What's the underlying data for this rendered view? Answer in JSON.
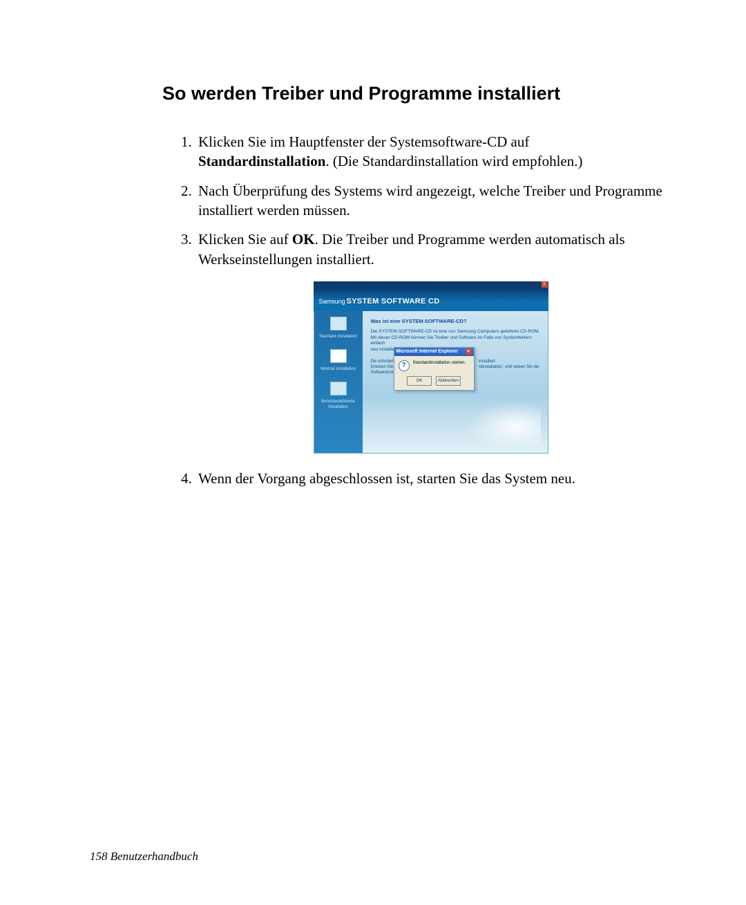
{
  "heading": "So werden Treiber und Programme installiert",
  "steps": {
    "s1_a": "Klicken Sie im Hauptfenster der Systemsoftware-CD auf ",
    "s1_bold": "Standardinstallation",
    "s1_b": ". (Die Standardinstallation wird empfohlen.)",
    "s2": "Nach Überprüfung des Systems wird angezeigt, welche Treiber und Programme installiert werden müssen.",
    "s3_a": "Klicken Sie auf ",
    "s3_bold": "OK",
    "s3_b": ". Die Treiber und Programme werden automatisch als Werkseinstellungen installiert.",
    "s4": "Wenn der Vorgang abgeschlossen ist, starten Sie das System neu."
  },
  "screenshot": {
    "close_x": "×",
    "brand_small": "Samsung",
    "brand_big": "SYSTEM SOFTWARE CD",
    "side": {
      "standard": "Standard Installation",
      "minimal": "Minimal Installation",
      "custom": "Benutzerdefinierte Installation"
    },
    "main": {
      "q": "Was ist eine SYSTEM-SOFTWARE-CD?",
      "desc1": "Die SYSTEM-SOFTWARE-CD ist eine von Samsung Computers gelieferte CD-ROM.",
      "desc2": "Mit dieser CD-ROM können Sie Treiber und Software im Falle von Systemfehlern einfach",
      "desc3": "neu installieren.",
      "left_cut1": "Die erforderli",
      "left_cut2": "Drücken Sie 'S",
      "left_cut3": "Softwareinsta",
      "right_cut1": "installiert.",
      "right_cut2": "rdinstallation', und setzen Sie die"
    },
    "dialog": {
      "title": "Microsoft Internet Explorer",
      "x": "×",
      "q_icon": "?",
      "message": "Standardinstallation starten.",
      "ok": "OK",
      "cancel": "Abbrechen"
    }
  },
  "footer": "158  Benutzerhandbuch"
}
